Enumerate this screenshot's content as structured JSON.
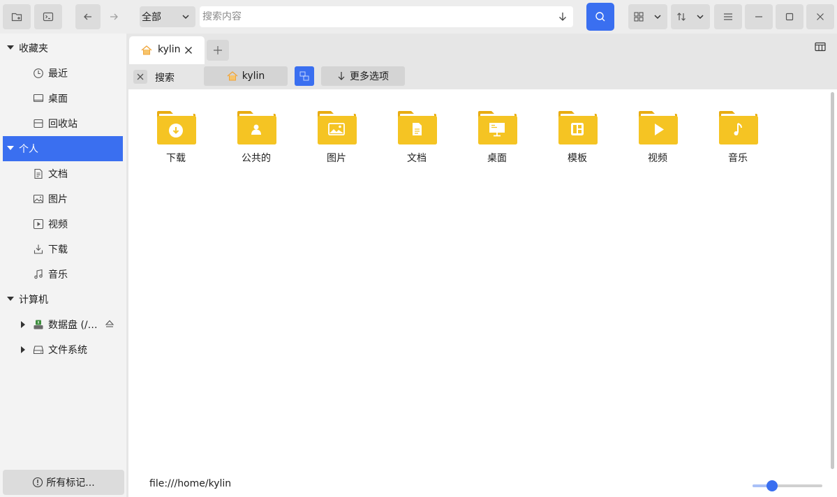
{
  "toolbar": {
    "scope_selected": "全部",
    "search_placeholder": "搜索内容"
  },
  "sidebar": {
    "favorites": {
      "label": "收藏夹",
      "items": [
        {
          "label": "最近",
          "icon": "clock-icon"
        },
        {
          "label": "桌面",
          "icon": "monitor-icon"
        },
        {
          "label": "回收站",
          "icon": "trash-icon"
        }
      ]
    },
    "personal": {
      "label": "个人",
      "items": [
        {
          "label": "文档",
          "icon": "document-icon"
        },
        {
          "label": "图片",
          "icon": "image-icon"
        },
        {
          "label": "视频",
          "icon": "video-icon"
        },
        {
          "label": "下载",
          "icon": "download-icon"
        },
        {
          "label": "音乐",
          "icon": "music-icon"
        }
      ]
    },
    "computer": {
      "label": "计算机",
      "items": [
        {
          "label": "数据盘 (/…",
          "icon": "drive-icon"
        },
        {
          "label": "文件系统",
          "icon": "harddisk-icon"
        }
      ]
    },
    "tags_button": "所有标记..."
  },
  "tabs": [
    {
      "label": "kylin"
    }
  ],
  "searchbar": {
    "label": "搜索",
    "location": "kylin",
    "more_options": "更多选项"
  },
  "folders": [
    {
      "name": "下载",
      "icon": "download-folder-icon"
    },
    {
      "name": "公共的",
      "icon": "public-folder-icon"
    },
    {
      "name": "图片",
      "icon": "pictures-folder-icon"
    },
    {
      "name": "文档",
      "icon": "documents-folder-icon"
    },
    {
      "name": "桌面",
      "icon": "desktop-folder-icon"
    },
    {
      "name": "模板",
      "icon": "templates-folder-icon"
    },
    {
      "name": "视频",
      "icon": "videos-folder-icon"
    },
    {
      "name": "音乐",
      "icon": "music-folder-icon"
    }
  ],
  "status": {
    "path": "file:///home/kylin",
    "zoom_level": 0.28
  },
  "colors": {
    "accent": "#3a6ff0",
    "folder": "#f5c423"
  }
}
